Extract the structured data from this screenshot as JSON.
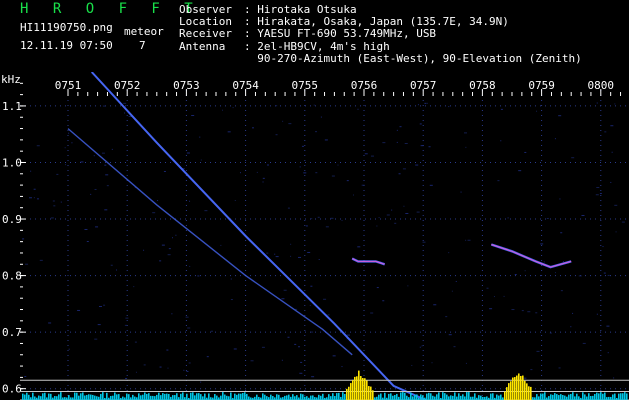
{
  "header": {
    "brand": "H R O F F T",
    "filename": "HI11190750.png",
    "timestamp": "12.11.19 07:50",
    "meteor_label": "meteor",
    "meteor_count": "7"
  },
  "station": [
    {
      "key": "Observer",
      "value": "Hirotaka Otsuka"
    },
    {
      "key": "Location",
      "value": "Hirakata, Osaka, Japan (135.7E, 34.9N)"
    },
    {
      "key": "Receiver",
      "value": "YAESU FT-690 53.749MHz, USB"
    },
    {
      "key": "Antenna",
      "value": "2el-HB9CV, 4m's high"
    },
    {
      "key": "",
      "value": "90-270-Azimuth (East-West), 90-Elevation (Zenith)"
    }
  ],
  "colors": {
    "brand": "#19e04a",
    "grid": "#2a3a8c",
    "signal": "#4a6cff",
    "echo_hot": "#ff5ad2",
    "spectrum": "#00c8e6",
    "spectrum_peak": "#ffe600",
    "hline": "#c8c8c8"
  },
  "chart_data": {
    "type": "line",
    "xlabel": "",
    "ylabel": "kHz",
    "x_ticks": [
      "0751",
      "0752",
      "0753",
      "0754",
      "0755",
      "0756",
      "0757",
      "0758",
      "0759",
      "0800"
    ],
    "y_ticks": [
      "1.1",
      "1.0",
      "0.9",
      "0.8",
      "0.7",
      "0.6"
    ],
    "ylim": [
      0.58,
      1.16
    ],
    "xlim": [
      0,
      9.3
    ],
    "grid": true,
    "series": [
      {
        "x": [
          0.4,
          1.5,
          3.0,
          4.5,
          5.5,
          6.15
        ],
        "y": [
          1.16,
          1.035,
          0.87,
          0.715,
          0.605,
          0.575
        ]
      },
      {
        "x": [
          0.0,
          1.5,
          3.0,
          4.3,
          4.8
        ],
        "y": [
          1.06,
          0.925,
          0.8,
          0.705,
          0.66
        ]
      },
      {
        "x": [
          4.8,
          4.9,
          5.2,
          5.35
        ],
        "y": [
          0.83,
          0.825,
          0.825,
          0.82
        ]
      },
      {
        "x": [
          7.15,
          7.5,
          7.9,
          8.15,
          8.5
        ],
        "y": [
          0.855,
          0.843,
          0.825,
          0.815,
          0.825
        ]
      }
    ],
    "meteor_echo_times": [
      4.9,
      7.6
    ],
    "baseline_levels_khz": [
      0.615,
      0.595,
      0.58
    ]
  }
}
